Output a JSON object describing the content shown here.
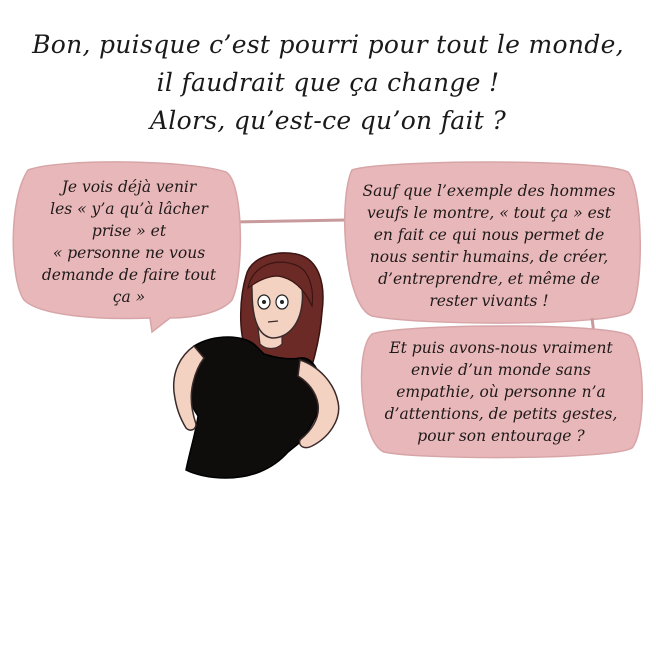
{
  "header": {
    "lines": [
      "Bon, puisque c’est pourri pour tout le monde,",
      "il faudrait que ça change !",
      "Alors, qu’est-ce qu’on fait ?"
    ]
  },
  "bubbles": [
    {
      "lines": [
        "Je vois déjà venir",
        "les « y’a qu’à lâcher",
        "prise » et",
        "« personne ne vous",
        "demande de faire tout",
        "ça »"
      ]
    },
    {
      "lines": [
        "Sauf que l’exemple des hommes",
        "veufs le montre, « tout ça » est",
        "en fait ce qui nous permet de",
        "nous sentir humains, de créer,",
        "d’entreprendre, et même de",
        "rester vivants !"
      ]
    },
    {
      "lines": [
        "Et puis avons-nous vraiment",
        "envie d’un monde sans",
        "empathie, où personne n’a",
        "d’attentions, de petits gestes,",
        "pour son entourage ?"
      ]
    }
  ],
  "colors": {
    "bubble_fill": "#e8b7b9",
    "bubble_stroke": "#c99a9c",
    "hair": "#6b2a26",
    "skin": "#f4d2c2",
    "shirt": "#0f0c0c"
  }
}
